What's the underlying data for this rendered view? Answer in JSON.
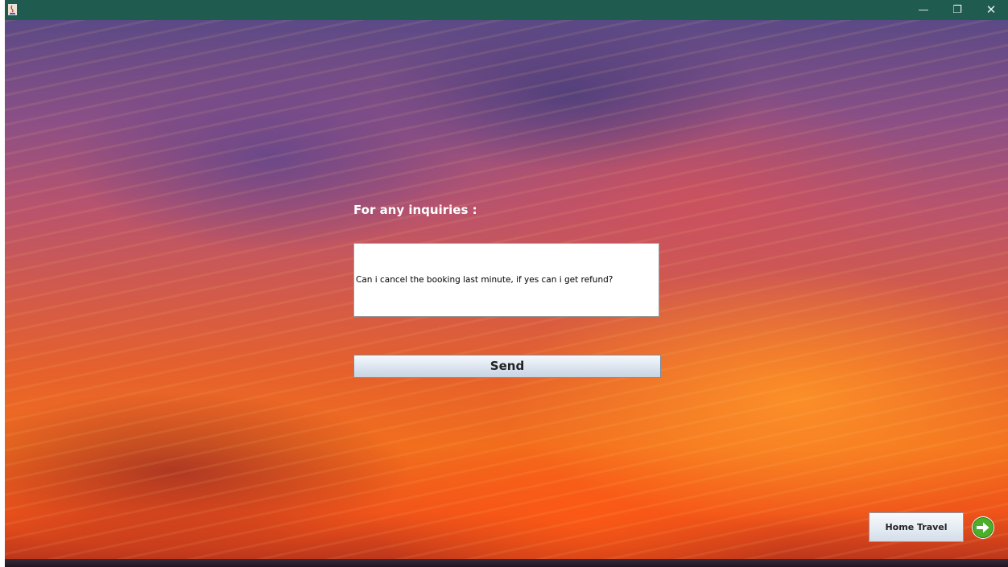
{
  "window": {
    "controls": {
      "minimize": "—",
      "restore": "❐",
      "close": "✕"
    }
  },
  "inquiry": {
    "label": "For any inquiries :",
    "message": "Can i cancel the booking last minute, if yes can i get refund?"
  },
  "buttons": {
    "send": "Send",
    "home": "Home Travel"
  },
  "icons": {
    "app": "java-app-icon",
    "next": "green-arrow-icon"
  },
  "colors": {
    "titlebar": "#1f5b4f",
    "arrow": "#4caf2a"
  }
}
